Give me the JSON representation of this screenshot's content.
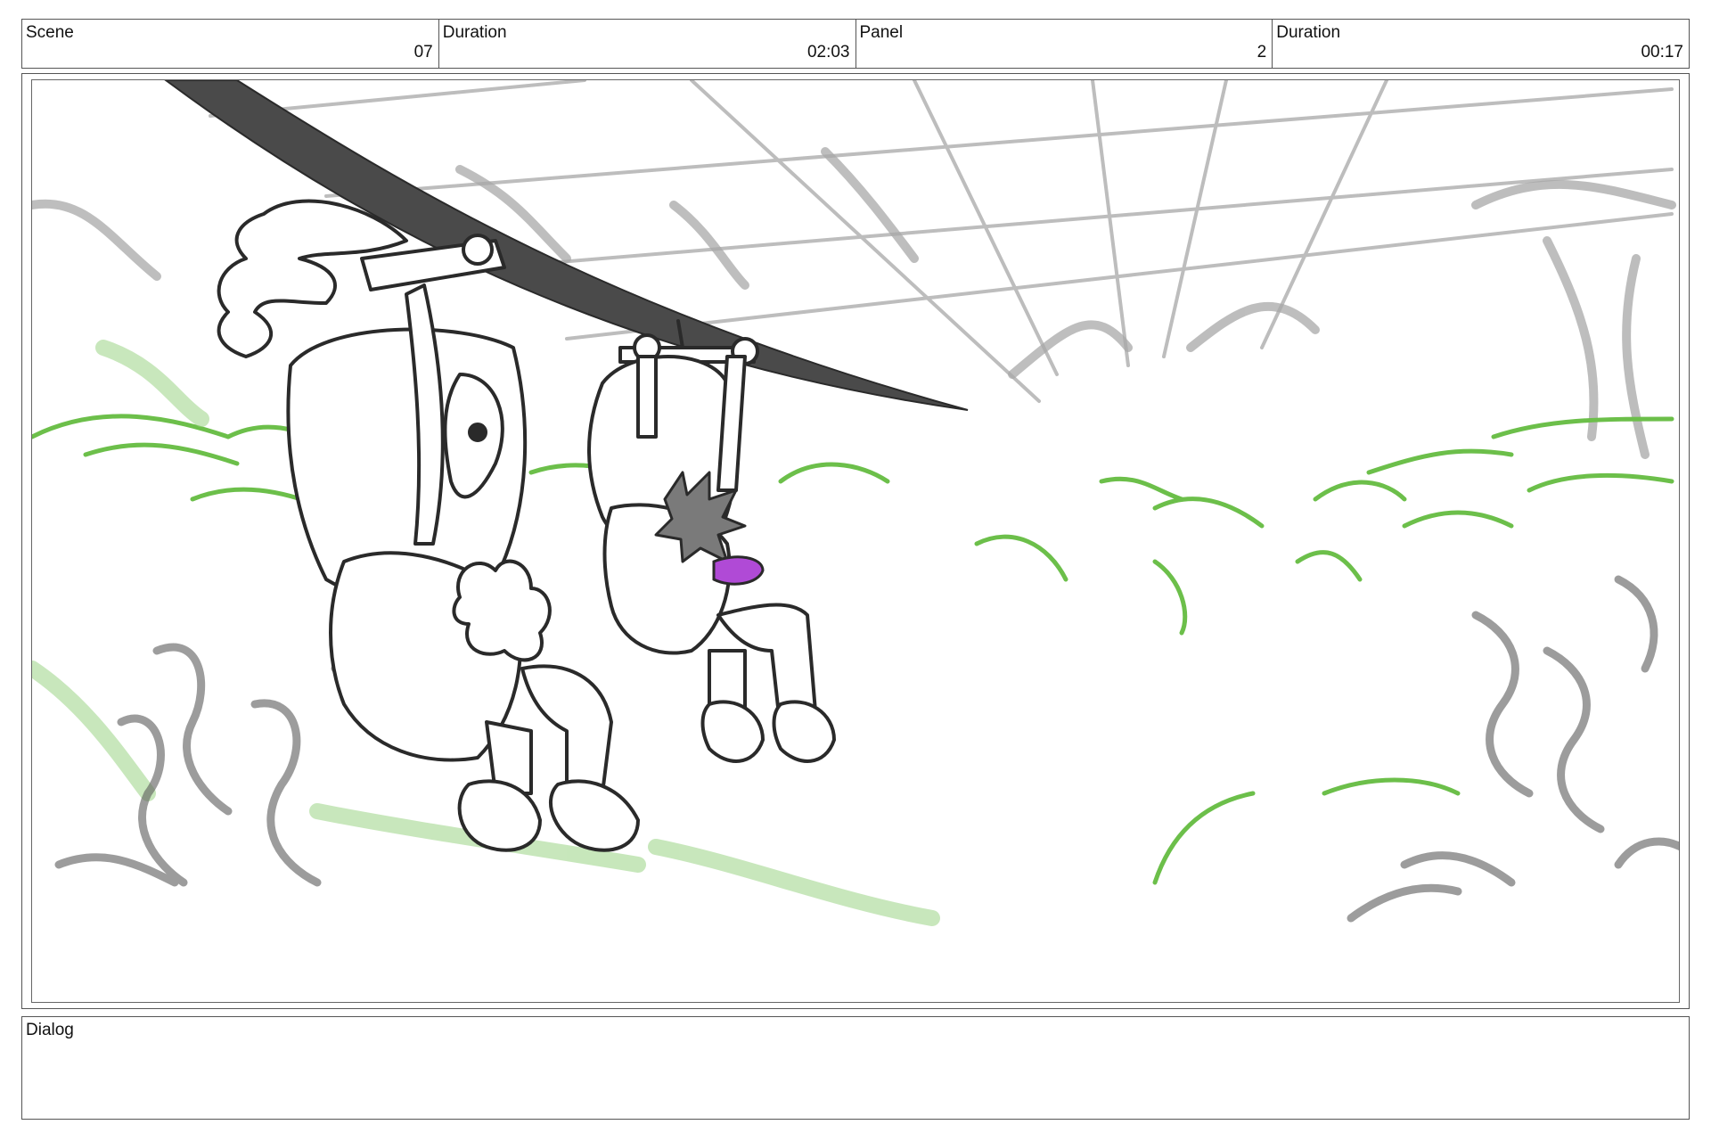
{
  "header": {
    "cells": [
      {
        "label": "Scene",
        "value": "07"
      },
      {
        "label": "Duration",
        "value": "02:03"
      },
      {
        "label": "Panel",
        "value": "2"
      },
      {
        "label": "Duration",
        "value": "00:17"
      }
    ]
  },
  "dialog": {
    "label": "Dialog",
    "text": ""
  },
  "panel": {
    "colors": {
      "foliage_green": "#6cbf4a",
      "sketch_gray": "#9a9a9a",
      "ink": "#2a2a2a",
      "cable": "#4a4a4a",
      "tongue_purple": "#b04ad6"
    }
  }
}
